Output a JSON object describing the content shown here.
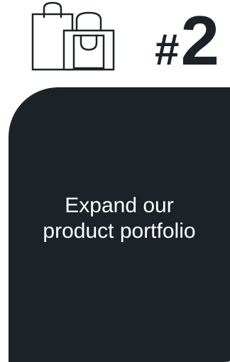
{
  "goal": {
    "hash": "#",
    "number": "2",
    "icon": "shopping-bags-icon",
    "text": "Expand our product portfolio"
  },
  "colors": {
    "card_background": "#1c2228",
    "card_text": "#ffffff",
    "number_text": "#1c2228",
    "icon_stroke": "#1c2228",
    "page_background": "#ffffff"
  }
}
